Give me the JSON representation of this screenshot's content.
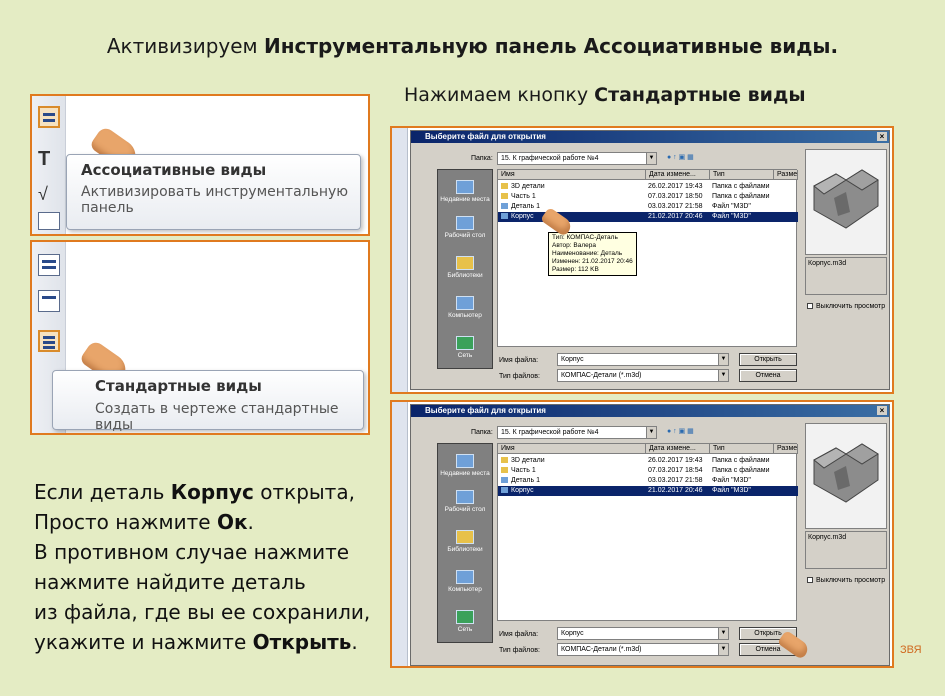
{
  "heading": {
    "prefix": "Активизируем ",
    "bold": "Инструментальную панель  Ассоциативные виды."
  },
  "subheading": {
    "prefix": "Нажимаем кнопку  ",
    "bold": "Стандартные виды"
  },
  "tooltip_assoc": {
    "title": "Ассоциативные виды",
    "desc_line1": "Активизировать инструментальную",
    "desc_line2": "панель"
  },
  "tooltip_std": {
    "title": "Стандартные виды",
    "desc": "Создать в чертеже стандартные виды"
  },
  "instructions": {
    "l1_a": "Если деталь ",
    "l1_b": "Корпус",
    "l1_c": " открыта,",
    "l2_a": "Просто нажмите ",
    "l2_b": "Ок",
    "l2_c": ".",
    "l3": "В противном случае нажмите",
    "l4": "нажмите найдите деталь",
    "l5": "из файла, где вы ее сохранили,",
    "l6_a": "укажите  и нажмите ",
    "l6_b": "Открыть",
    "l6_c": "."
  },
  "dialog": {
    "title": "Выберите файл для открытия",
    "folder_label": "Папка:",
    "folder_value": "15. К графической работе №4",
    "columns": [
      "Имя",
      "Дата измене...",
      "Тип",
      "Разме"
    ],
    "places": [
      "Недавние места",
      "Рабочий стол",
      "Библиотеки",
      "Компьютер",
      "Сеть"
    ],
    "filename_label": "Имя файла:",
    "filename_value": "Корпус",
    "filetype_label": "Тип файлов:",
    "filetype_value": "КОМПАС-Детали (*.m3d)",
    "open_button": "Открыть",
    "cancel_button": "Отмена",
    "preview_name": "Корпус.m3d",
    "preview_toggle": "Выключить просмотр"
  },
  "dialog1_rows": [
    {
      "name": "3D детали",
      "date": "26.02.2017 19:43",
      "type": "Папка с файлами",
      "selected": false
    },
    {
      "name": "Часть 1",
      "date": "07.03.2017 18:50",
      "type": "Папка с файлами",
      "selected": false
    },
    {
      "name": "Деталь 1",
      "date": "03.03.2017 21:58",
      "type": "Файл \"M3D\"",
      "selected": false
    },
    {
      "name": "Корпус",
      "date": "21.02.2017 20:46",
      "type": "Файл \"M3D\"",
      "selected": true
    }
  ],
  "dialog2_rows": [
    {
      "name": "3D детали",
      "date": "26.02.2017 19:43",
      "type": "Папка с файлами",
      "selected": false
    },
    {
      "name": "Часть 1",
      "date": "07.03.2017 18:54",
      "type": "Папка с файлами",
      "selected": false
    },
    {
      "name": "Деталь 1",
      "date": "03.03.2017 21:58",
      "type": "Файл \"M3D\"",
      "selected": false
    },
    {
      "name": "Корпус",
      "date": "21.02.2017 20:46",
      "type": "Файл \"M3D\"",
      "selected": true
    }
  ],
  "file_tooltip": {
    "l1": "Тип: КОМПАС-Деталь",
    "l2": "Автор: Валера",
    "l3": "Наименование: Деталь",
    "l4": "Изменен: 21.02.2017 20:46",
    "l5": "Размер: 112 KB"
  },
  "signature": "ЗВЯ",
  "colors": {
    "accent_border": "#e07a1f",
    "background": "#e4ecc4",
    "selection": "#0a246a"
  }
}
